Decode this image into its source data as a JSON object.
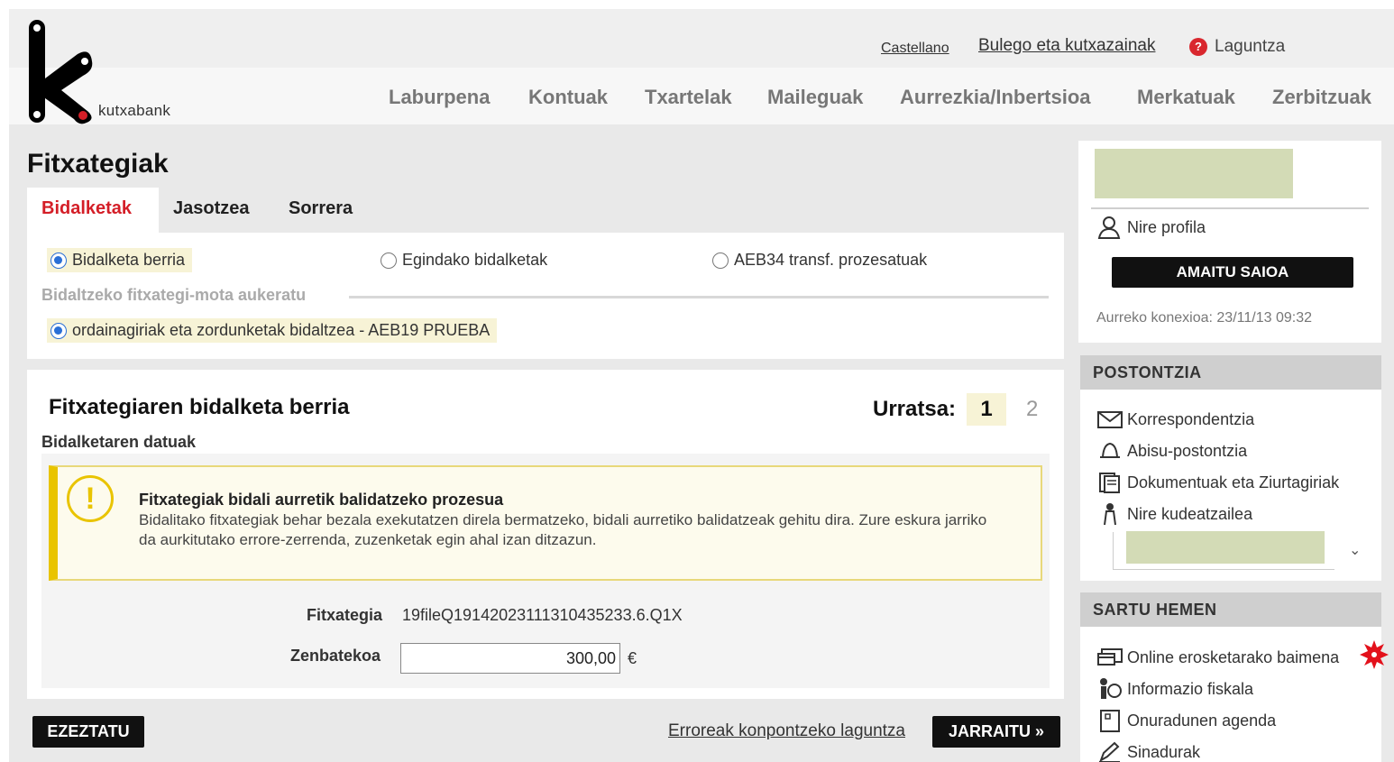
{
  "brand": {
    "name": "kutxabank"
  },
  "toplinks": {
    "language": "Castellano",
    "offices": "Bulego eta kutxazainak",
    "help": "Laguntza"
  },
  "nav": [
    "Laburpena",
    "Kontuak",
    "Txartelak",
    "Maileguak",
    "Aurrezkia/Inbertsioa",
    "Merkatuak",
    "Zerbitzuak"
  ],
  "page": {
    "title": "Fitxategiak"
  },
  "tabs": [
    "Bidalketak",
    "Jasotzea",
    "Sorrera"
  ],
  "modes": {
    "options": [
      "Bidalketa berria",
      "Egindako bidalketak",
      "AEB34 transf. prozesatuak"
    ],
    "selected": "Bidalketa berria"
  },
  "filetype": {
    "heading": "Bidaltzeko fitxategi-mota aukeratu",
    "option": "ordainagiriak eta zordunketak bidaltzea - AEB19 PRUEBA"
  },
  "form": {
    "title": "Fitxategiaren bidalketa berria",
    "step_label": "Urratsa:",
    "step_current": "1",
    "step_next": "2",
    "subtitle": "Bidalketaren datuak",
    "alert_title": "Fitxategiak bidali aurretik balidatzeko prozesua",
    "alert_body": "Bidalitako fitxategiak behar bezala exekutatzen direla bermatzeko, bidali aurretiko balidatzeak gehitu dira. Zure eskura jarriko da aurkitutako errore-zerrenda, zuzenketak egin ahal izan ditzazun.",
    "file_label": "Fitxategia",
    "file_value": "19fileQ19142023111310435233.6.Q1X",
    "amount_label": "Zenbatekoa",
    "amount_value": "300,00",
    "currency": "€"
  },
  "actions": {
    "delete": "EZEZTATU",
    "help_link": "Erroreak konpontzeko laguntza",
    "continue": "JARRAITU »"
  },
  "sidebar": {
    "profile": "Nire profila",
    "logout": "AMAITU SAIOA",
    "last_connection": "Aurreko konexioa: 23/11/13 09:32",
    "mailbox_title": "POSTONTZIA",
    "mailbox_items": [
      "Korrespondentzia",
      "Abisu-postontzia",
      "Dokumentuak eta Ziurtagiriak",
      "Nire kudeatzailea"
    ],
    "enter_title": "SARTU HEMEN",
    "enter_items": [
      "Online erosketarako baimena",
      "Informazio fiskala",
      "Onuradunen agenda",
      "Sinadurak"
    ]
  },
  "colors": {
    "accent_red": "#d41e27",
    "brand_black": "#111111",
    "warning_yellow": "#e9c400",
    "placeholder": "#d3dbb6"
  }
}
